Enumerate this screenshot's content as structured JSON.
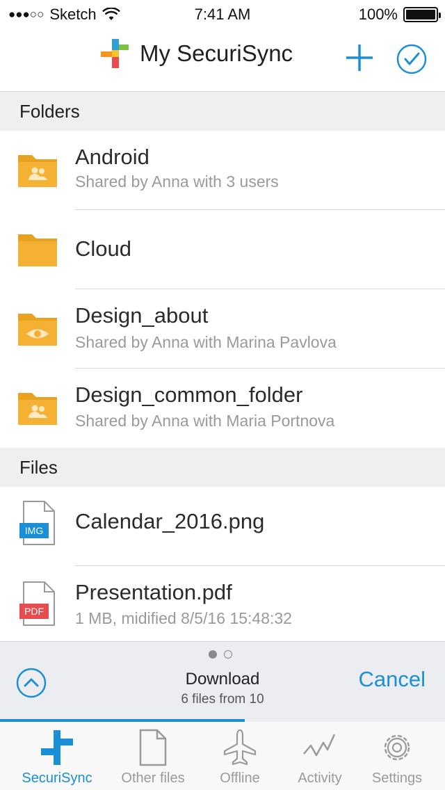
{
  "status_bar": {
    "carrier": "Sketch",
    "time": "7:41 AM",
    "battery": "100%"
  },
  "nav": {
    "title": "My SecuriSync"
  },
  "sections": {
    "folders": "Folders",
    "files": "Files"
  },
  "folders": [
    {
      "name": "Android",
      "subtitle": "Shared by Anna with 3 users",
      "icon": "shared-folder-icon"
    },
    {
      "name": "Cloud",
      "subtitle": "",
      "icon": "folder-icon"
    },
    {
      "name": "Design_about",
      "subtitle": "Shared by Anna with Marina Pavlova",
      "icon": "view-only-folder-icon"
    },
    {
      "name": "Design_common_folder",
      "subtitle": "Shared by Anna with Maria Portnova",
      "icon": "shared-folder-icon"
    }
  ],
  "files": [
    {
      "name": "Calendar_2016.png",
      "subtitle": "",
      "badge": "IMG",
      "badge_color": "#1a8fd6"
    },
    {
      "name": "Presentation.pdf",
      "subtitle": "1 MB, midified 8/5/16 15:48:32",
      "badge": "PDF",
      "badge_color": "#e84c4f"
    }
  ],
  "download": {
    "title": "Download",
    "subtitle": "6 files from 10",
    "cancel": "Cancel",
    "progress": 0.55
  },
  "tabs": [
    {
      "label": "SecuriSync",
      "icon": "securisync-icon",
      "active": true
    },
    {
      "label": "Other files",
      "icon": "file-icon",
      "active": false
    },
    {
      "label": "Offline",
      "icon": "airplane-icon",
      "active": false
    },
    {
      "label": "Activity",
      "icon": "activity-icon",
      "active": false
    },
    {
      "label": "Settings",
      "icon": "gear-icon",
      "active": false
    }
  ],
  "colors": {
    "accent": "#1a8fd6",
    "folder": "#f5b133",
    "section_bg": "#efefef"
  }
}
